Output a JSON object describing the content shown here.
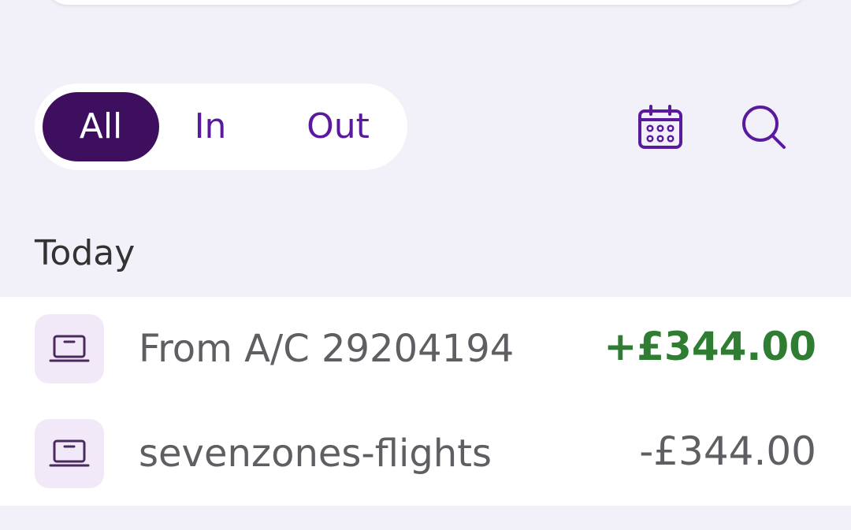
{
  "filters": {
    "all": "All",
    "in": "In",
    "out": "Out",
    "selected": "All"
  },
  "toolbar": {
    "calendar_icon": "calendar-icon",
    "search_icon": "search-icon"
  },
  "section": {
    "title": "Today"
  },
  "transactions": [
    {
      "title": "From A/C 29204194",
      "amount": "+£344.00",
      "icon": "laptop-icon",
      "direction": "in"
    },
    {
      "title": "sevenzones-flights",
      "amount": "-£344.00",
      "icon": "laptop-icon",
      "direction": "out"
    }
  ],
  "colors": {
    "background": "#f2f0f8",
    "accent": "#5a1a9e",
    "active_chip": "#3d0f5e",
    "positive": "#2e7d32",
    "neutral_text": "#5e5e63"
  }
}
